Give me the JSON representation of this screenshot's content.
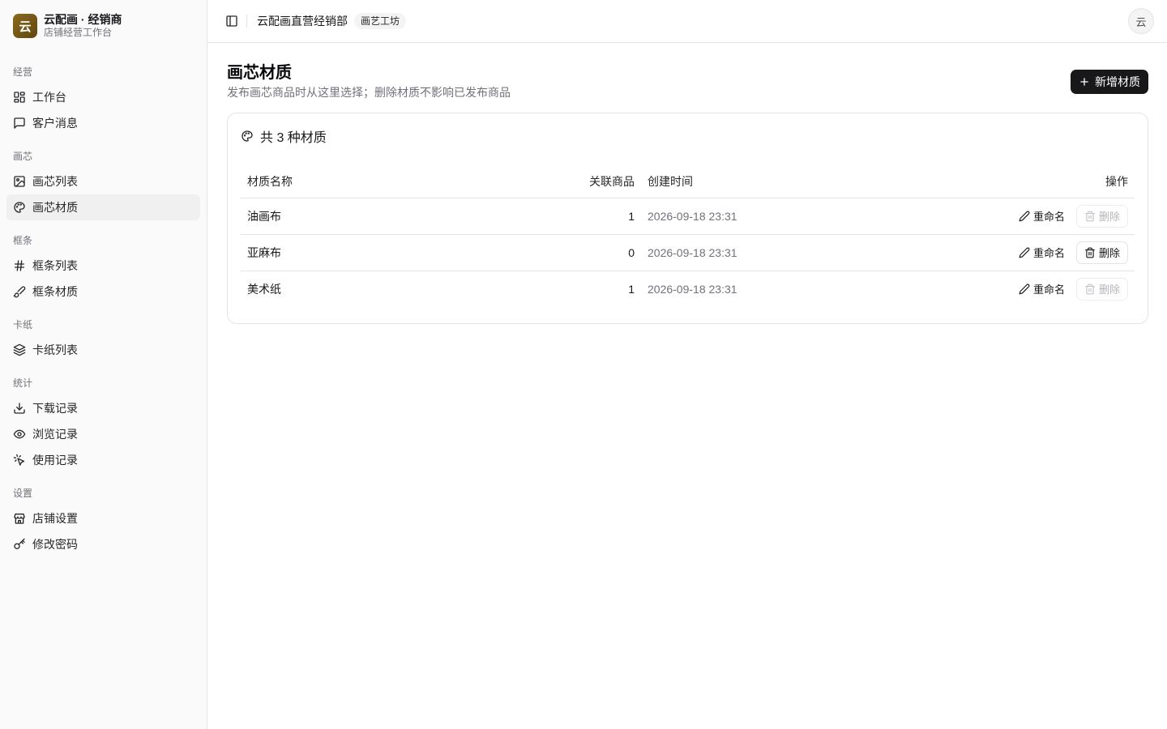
{
  "brand": {
    "logo_char": "云",
    "title": "云配画 · 经销商",
    "subtitle": "店铺经营工作台"
  },
  "sidebar": {
    "groups": [
      {
        "label": "经营",
        "items": [
          {
            "label": "工作台",
            "icon": "dashboard-icon"
          },
          {
            "label": "客户消息",
            "icon": "message-icon"
          }
        ]
      },
      {
        "label": "画芯",
        "items": [
          {
            "label": "画芯列表",
            "icon": "image-icon"
          },
          {
            "label": "画芯材质",
            "icon": "palette-icon",
            "active": true
          }
        ]
      },
      {
        "label": "框条",
        "items": [
          {
            "label": "框条列表",
            "icon": "hash-icon"
          },
          {
            "label": "框条材质",
            "icon": "brush-icon"
          }
        ]
      },
      {
        "label": "卡纸",
        "items": [
          {
            "label": "卡纸列表",
            "icon": "layers-icon"
          }
        ]
      },
      {
        "label": "统计",
        "items": [
          {
            "label": "下载记录",
            "icon": "download-icon"
          },
          {
            "label": "浏览记录",
            "icon": "eye-icon"
          },
          {
            "label": "使用记录",
            "icon": "pointer-icon"
          }
        ]
      },
      {
        "label": "设置",
        "items": [
          {
            "label": "店铺设置",
            "icon": "store-icon"
          },
          {
            "label": "修改密码",
            "icon": "key-icon"
          }
        ]
      }
    ]
  },
  "topbar": {
    "store_name": "云配画直营经销部",
    "store_badge": "画艺工坊",
    "avatar_char": "云"
  },
  "page": {
    "title": "画芯材质",
    "description": "发布画芯商品时从这里选择；删除材质不影响已发布商品",
    "add_button": "新增材质"
  },
  "card": {
    "title": "共 3 种材质"
  },
  "table": {
    "columns": [
      "材质名称",
      "关联商品",
      "创建时间",
      "操作"
    ],
    "rows": [
      {
        "name": "油画布",
        "count": "1",
        "created": "2026-09-18 23:31",
        "delete_enabled": false
      },
      {
        "name": "亚麻布",
        "count": "0",
        "created": "2026-09-18 23:31",
        "delete_enabled": true
      },
      {
        "name": "美术纸",
        "count": "1",
        "created": "2026-09-18 23:31",
        "delete_enabled": false
      }
    ],
    "rename_label": "重命名",
    "delete_label": "删除"
  }
}
